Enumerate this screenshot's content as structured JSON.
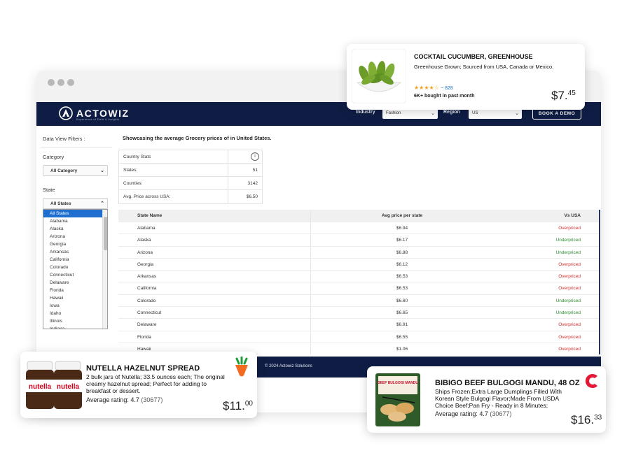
{
  "nav": {
    "brand": "ACTOWIZ",
    "tagline": "Experience of Data & Insights",
    "industry_label": "Industry",
    "industry_value": "Fashion",
    "region_label": "Region",
    "region_value": "US",
    "demo_label": "BOOK A DEMO"
  },
  "sidebar": {
    "title": "Data View Filters :",
    "category_label": "Category",
    "category_value": "All Category",
    "state_label": "State",
    "state_value": "All States",
    "states": [
      "All States",
      "Alabama",
      "Alaska",
      "Arizona",
      "Georgia",
      "Arkansas",
      "California",
      "Colorado",
      "Connecticut",
      "Delaware",
      "Florida",
      "Hawaii",
      "Iowa",
      "Idaho",
      "Illinois",
      "Indiana"
    ]
  },
  "main": {
    "heading": "Showcasing the average Grocery prices of in United States.",
    "stats_title": "Country Stats",
    "stats": [
      {
        "label": "States:",
        "value": "51"
      },
      {
        "label": "Counties:",
        "value": "3142"
      },
      {
        "label": "Avg. Price across USA:",
        "value": "$6.50"
      }
    ],
    "table": {
      "headers": [
        "State Name",
        "Avg price per state",
        "Vs USA"
      ],
      "rows": [
        {
          "state": "Alabama",
          "price": "$6.94",
          "vs": "Overpriced"
        },
        {
          "state": "Alaska",
          "price": "$6.17",
          "vs": "Underpriced"
        },
        {
          "state": "Arizona",
          "price": "$6.88",
          "vs": "Underpriced"
        },
        {
          "state": "Georgia",
          "price": "$6.12",
          "vs": "Overpriced"
        },
        {
          "state": "Arkansas",
          "price": "$6.53",
          "vs": "Overpriced"
        },
        {
          "state": "California",
          "price": "$6.53",
          "vs": "Overpriced"
        },
        {
          "state": "Colorado",
          "price": "$6.60",
          "vs": "Underpriced"
        },
        {
          "state": "Connecticut",
          "price": "$6.65",
          "vs": "Underpriced"
        },
        {
          "state": "Delaware",
          "price": "$6.91",
          "vs": "Overpriced"
        },
        {
          "state": "Florida",
          "price": "$6.55",
          "vs": "Overpriced"
        },
        {
          "state": "Hawaii",
          "price": "$1.06",
          "vs": "Overpriced"
        }
      ]
    }
  },
  "footer": {
    "copyright": "© 2024 Actowiz Solutions"
  },
  "cards": {
    "cucumber": {
      "title": "COCKTAIL CUCUMBER, GREENHOUSE",
      "desc": "Greenhouse Grown; Sourced from USA, Canada or Mexico.",
      "stars": "★★★★☆",
      "reviews": "~ 828",
      "bought": "6K+ bought in past month",
      "price_main": "$7.",
      "price_cents": "45"
    },
    "nutella": {
      "title": "NUTELLA HAZELNUT SPREAD",
      "desc": "2 bulk jars of Nutella; 33.5 ounces each; The original creamy hazelnut spread; Perfect for adding to breakfast or dessert.",
      "rating_label": "Average rating: 4.7",
      "rating_count": "(30677)",
      "price_main": "$11.",
      "price_cents": "00",
      "jar_text": "nutella"
    },
    "bibigo": {
      "title": "BIBIGO BEEF BULGOGI MANDU, 48 OZ",
      "desc": "Ships Frozen;Extra Large Dumplings Filled With Korean Style Bulgogi Flavor;Made From USDA Choice Beef;Pan Fry - Ready in 8 Minutes;",
      "rating_label": "Average rating: 4.7",
      "rating_count": "(30677)",
      "price_main": "$16.",
      "price_cents": "33",
      "box_text": "BEEF BULGOGI MANDU"
    }
  },
  "colors": {
    "navy": "#0f1d45",
    "overpriced": "#d32f2f",
    "underpriced": "#2e8b2e",
    "selected": "#1e6fd0"
  }
}
